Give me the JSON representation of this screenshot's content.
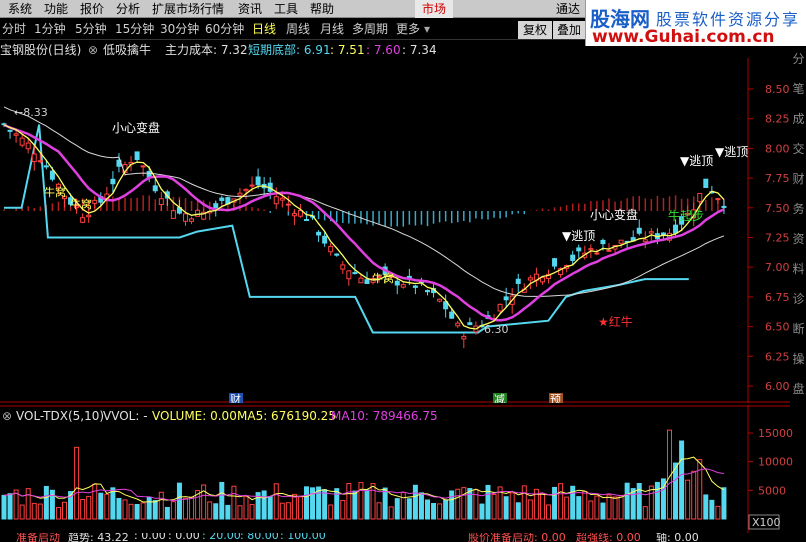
{
  "menu": [
    "系统",
    "功能",
    "报价",
    "分析",
    "扩展市场行情",
    "资讯",
    "工具",
    "帮助"
  ],
  "menu_extra": "通达",
  "market_tab": "市场",
  "logo": {
    "main": "股海网",
    "sub": "股票软件资源分享",
    "url": "www.Guhai.com.cn"
  },
  "periods": [
    "分时",
    "1分钟",
    "5分钟",
    "15分钟",
    "30分钟",
    "60分钟",
    "日线",
    "周线",
    "月线",
    "多周期",
    "更多"
  ],
  "active_period": "日线",
  "buttons": {
    "restore": "复权",
    "overlay": "叠加"
  },
  "info": {
    "stock": "宝钢股份(日线)",
    "indicator": "低吸擒牛",
    "cost_label": "主力成本: 7.32",
    "bottom_label": "短期底部: 6.91",
    "v1": ": 7.51",
    "v2": ": 7.60",
    "v3": ": 7.34"
  },
  "price_axis": [
    "8.50",
    "8.25",
    "8.00",
    "7.75",
    "7.50",
    "7.25",
    "7.00",
    "6.75",
    "6.50",
    "6.25",
    "6.00"
  ],
  "vol_axis": [
    "15000",
    "10000",
    "5000"
  ],
  "vol_unit": "X100",
  "annotations": {
    "high_price": "8.33",
    "low_price": "6.30",
    "careful1": "小心变盘",
    "careful2": "小心变盘",
    "escape1": "▼逃顶",
    "escape2": "▼逃顶",
    "escape3": "▼逃顶",
    "niu1": "牛窝",
    "niu2": "牛窝",
    "niu3": "牛窝",
    "niu_start": "牛起步",
    "red_niu": "★红牛",
    "cai": "财",
    "jian": "减",
    "yu": "预"
  },
  "vol_header": {
    "name": "VOL-TDX(5,10)",
    "vvol": "VVOL: -",
    "volume": "VOLUME: 0.00",
    "ma5": "MA5: 676190.25",
    "ma10": "MA10: 789466.75"
  },
  "bottom": {
    "a": "准备启动",
    "b": "趋势: 43.22",
    "c": ": 0.00",
    "d": ": 0.00",
    "e": ": 20.00",
    "f": ": 80.00",
    "g": ": 100.00",
    "h": "股价准备启动: 0.00",
    "i": "超强线: 0.00",
    "j": "轴: 0.00"
  },
  "sidebar_chars": [
    "分",
    "笔",
    "成",
    "交",
    "财",
    "务",
    "资",
    "料",
    "诊",
    "断",
    "操",
    "盘"
  ],
  "colors": {
    "up": "#ff4040",
    "down": "#54d8f0",
    "ma_pink": "#e040e0",
    "ma_yellow": "#ffff60",
    "ma_white": "#e0e0e0",
    "axis_red": "#b00000"
  }
}
